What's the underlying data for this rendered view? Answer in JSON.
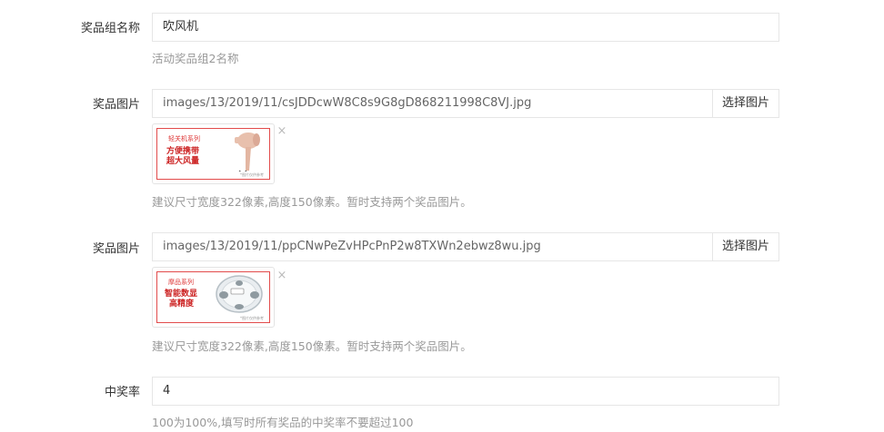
{
  "prize_group": {
    "label": "奖品组名称",
    "value": "吹风机",
    "hint": "活动奖品组2名称"
  },
  "images": [
    {
      "label": "奖品图片",
      "path": "images/13/2019/11/csJDDcwW8C8s9G8gD868211998C8VJ.jpg",
      "button": "选择图片",
      "hint": "建议尺寸宽度322像素,高度150像素。暂时支持两个奖品图片。",
      "remove_glyph": "×",
      "preview": {
        "series": "轻关机系列",
        "line1": "方便携带",
        "line2": "超大风量",
        "tiny": "*图片仅供参考",
        "icon": "hair-dryer-icon"
      }
    },
    {
      "label": "奖品图片",
      "path": "images/13/2019/11/ppCNwPeZvHPcPnP2w8TXWn2ebwz8wu.jpg",
      "button": "选择图片",
      "hint": "建议尺寸宽度322像素,高度150像素。暂时支持两个奖品图片。",
      "remove_glyph": "×",
      "preview": {
        "series": "摩品系列",
        "line1": "智能数显",
        "line2": "高精度",
        "tiny": "*图片仅供参考",
        "icon": "scale-icon"
      }
    }
  ],
  "win_rate": {
    "label": "中奖率",
    "value": "4",
    "hint": "100为100%,填写时所有奖品的中奖率不要超过100"
  },
  "colors": {
    "border": "#e6e6e6",
    "hint": "#999999",
    "accent_red": "#e24b4b"
  }
}
